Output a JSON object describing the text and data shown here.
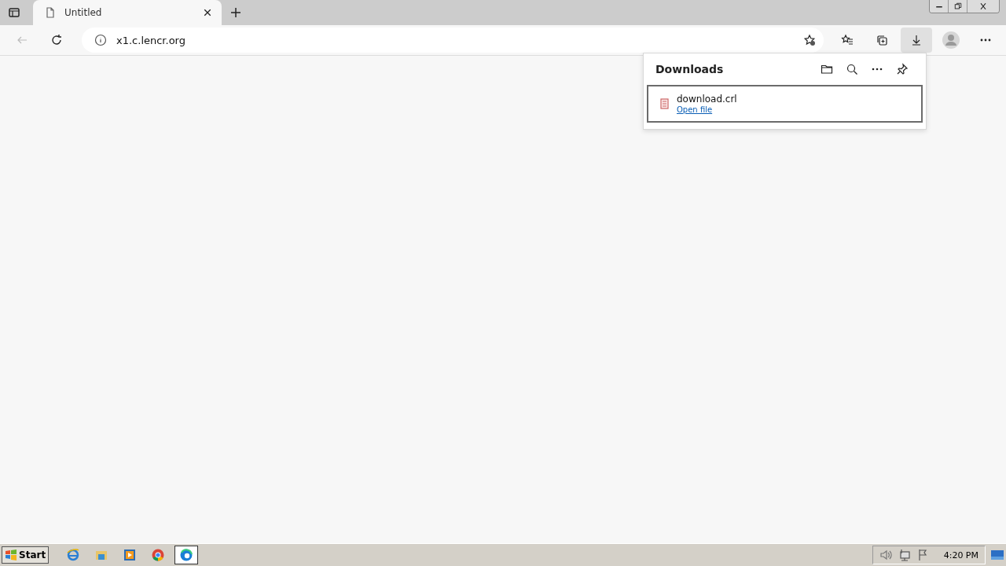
{
  "tabs": [
    {
      "title": "Untitled",
      "selected": true
    }
  ],
  "address_bar": {
    "url": "x1.c.lencr.org"
  },
  "toolbar": {
    "downloads_active": true
  },
  "downloads_panel": {
    "title": "Downloads",
    "items": [
      {
        "file_name": "download.crl",
        "link": "Open file"
      }
    ]
  },
  "taskbar": {
    "start": "Start",
    "apps": [
      {
        "kind": "ie",
        "selected": false
      },
      {
        "kind": "explorer",
        "selected": false
      },
      {
        "kind": "media",
        "selected": false
      },
      {
        "kind": "chrome",
        "selected": false
      },
      {
        "kind": "edge",
        "selected": true
      }
    ],
    "clock": "4:20 PM"
  }
}
